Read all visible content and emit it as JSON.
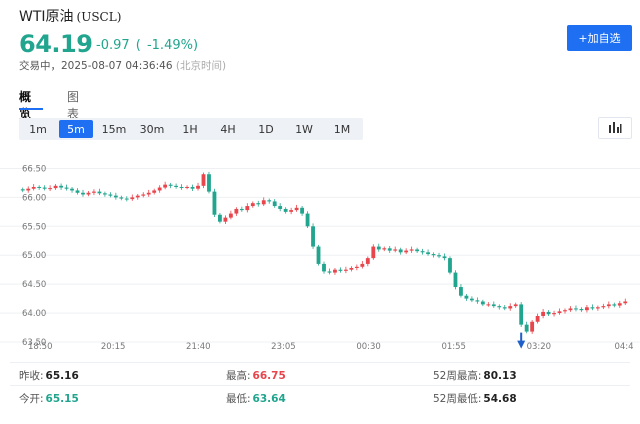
{
  "header": {
    "name": "WTI原油",
    "symbol": "(USCL)",
    "price": "64.19",
    "change": "-0.97 ( -1.49%)",
    "status": "交易中，2025-08-07 04:36:46",
    "timezone": "(北京时间)",
    "watch_button": "+加自选"
  },
  "tabs": [
    {
      "label": "概览",
      "active": true
    },
    {
      "label": "图表",
      "active": false
    }
  ],
  "intervals": [
    {
      "label": "1m",
      "active": false
    },
    {
      "label": "5m",
      "active": true
    },
    {
      "label": "15m",
      "active": false
    },
    {
      "label": "30m",
      "active": false
    },
    {
      "label": "1H",
      "active": false
    },
    {
      "label": "4H",
      "active": false
    },
    {
      "label": "1D",
      "active": false
    },
    {
      "label": "1W",
      "active": false
    },
    {
      "label": "1M",
      "active": false
    }
  ],
  "toolbar": {
    "settings_icon": "bar-chart-settings-icon"
  },
  "colors": {
    "up": "#e8454c",
    "down": "#21a58e",
    "accent": "#1e6ff2"
  },
  "chart_data": {
    "type": "candlestick",
    "y_ticks": [
      "66.50",
      "66.00",
      "65.50",
      "65.00",
      "64.50",
      "64.00",
      "63.50"
    ],
    "ylim": [
      63.5,
      66.75
    ],
    "x_ticks": [
      "18:50",
      "20:15",
      "21:40",
      "23:05",
      "00:30",
      "01:55",
      "03:20",
      "04:4"
    ],
    "close_series": [
      66.12,
      66.15,
      66.18,
      66.17,
      66.15,
      66.16,
      66.2,
      66.17,
      66.15,
      66.12,
      66.08,
      66.05,
      66.08,
      66.1,
      66.07,
      66.05,
      66.03,
      66.0,
      65.98,
      65.97,
      66.0,
      66.03,
      66.05,
      66.08,
      66.12,
      66.17,
      66.22,
      66.2,
      66.18,
      66.17,
      66.18,
      66.15,
      66.2,
      66.4,
      66.1,
      65.7,
      65.58,
      65.65,
      65.72,
      65.8,
      65.78,
      65.85,
      65.9,
      65.88,
      65.95,
      65.93,
      65.85,
      65.8,
      65.75,
      65.78,
      65.82,
      65.72,
      65.5,
      65.15,
      64.85,
      64.72,
      64.7,
      64.75,
      64.73,
      64.75,
      64.78,
      64.8,
      64.85,
      64.95,
      65.15,
      65.1,
      65.12,
      65.08,
      65.1,
      65.05,
      65.08,
      65.1,
      65.07,
      65.05,
      65.02,
      65.0,
      64.98,
      64.95,
      64.7,
      64.45,
      64.3,
      64.25,
      64.22,
      64.2,
      64.15,
      64.15,
      64.12,
      64.1,
      64.08,
      64.12,
      64.15,
      63.8,
      63.68,
      63.85,
      63.95,
      64.02,
      63.98,
      64.0,
      64.03,
      64.05,
      64.08,
      64.07,
      64.05,
      64.1,
      64.08,
      64.1,
      64.12,
      64.15,
      64.13,
      64.17,
      64.2
    ],
    "markers": [
      {
        "label": "arrow-down",
        "index": 91
      }
    ]
  },
  "stats": [
    {
      "label": "昨收:",
      "value": "65.16",
      "tone": "neutral"
    },
    {
      "label": "最高:",
      "value": "66.75",
      "tone": "up"
    },
    {
      "label": "52周最高:",
      "value": "80.13",
      "tone": "neutral"
    },
    {
      "label": "今开:",
      "value": "65.15",
      "tone": "down"
    },
    {
      "label": "最低:",
      "value": "63.64",
      "tone": "down"
    },
    {
      "label": "52周最低:",
      "value": "54.68",
      "tone": "neutral"
    }
  ]
}
